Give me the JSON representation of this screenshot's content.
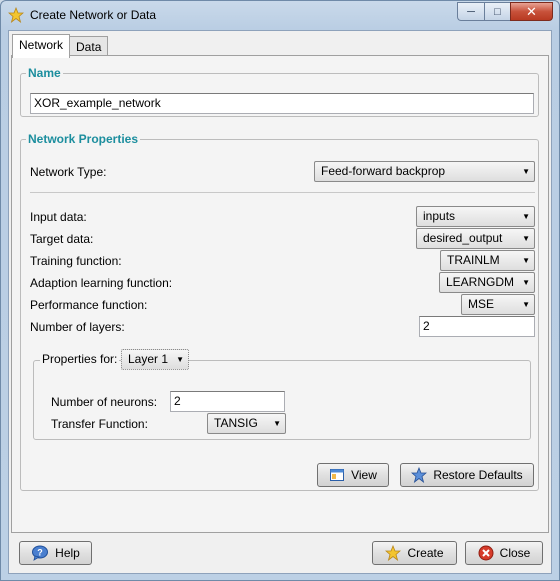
{
  "window": {
    "title": "Create Network or Data",
    "min_glyph": "─",
    "max_glyph": "□",
    "close_glyph": "✕"
  },
  "tabs": [
    {
      "label": "Network",
      "active": true
    },
    {
      "label": "Data",
      "active": false
    }
  ],
  "name_group": {
    "title": "Name",
    "value": "XOR_example_network"
  },
  "props_group": {
    "title": "Network Properties",
    "network_type_label": "Network Type:",
    "network_type_value": "Feed-forward backprop",
    "input_data_label": "Input data:",
    "input_data_value": "inputs",
    "target_data_label": "Target data:",
    "target_data_value": "desired_output",
    "training_fn_label": "Training function:",
    "training_fn_value": "TRAINLM",
    "adaption_fn_label": "Adaption learning function:",
    "adaption_fn_value": "LEARNGDM",
    "performance_fn_label": "Performance function:",
    "performance_fn_value": "MSE",
    "num_layers_label": "Number of layers:",
    "num_layers_value": "2"
  },
  "layer_props": {
    "label": "Properties for:",
    "layer_value": "Layer 1",
    "neurons_label": "Number of neurons:",
    "neurons_value": "2",
    "transfer_label": "Transfer Function:",
    "transfer_value": "TANSIG"
  },
  "buttons": {
    "view": "View",
    "restore": "Restore Defaults",
    "help": "Help",
    "create": "Create",
    "close": "Close"
  },
  "icons": {
    "app": "star-icon",
    "view": "window-icon",
    "restore": "star-icon",
    "help": "help-bubble-icon",
    "create": "star-icon",
    "close": "close-circle-icon"
  }
}
